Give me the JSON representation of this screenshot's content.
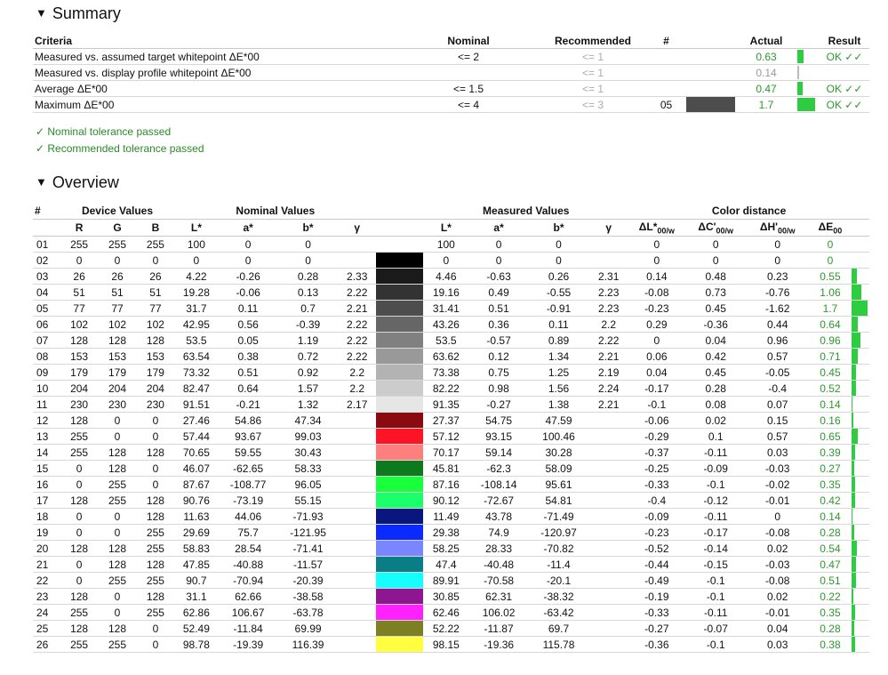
{
  "summary": {
    "title": "Summary",
    "headers": {
      "criteria": "Criteria",
      "nominal": "Nominal",
      "recommended": "Recommended",
      "num": "#",
      "actual": "Actual",
      "result": "Result"
    },
    "rows": [
      {
        "criteria": "Measured vs. assumed target whitepoint ΔE*00",
        "nominal": "<= 2",
        "recommended": "<= 1",
        "num": "",
        "swatch": "",
        "actual": "0.63",
        "bar": 0.37,
        "result": "OK ✓✓"
      },
      {
        "criteria": "Measured vs. display profile whitepoint ΔE*00",
        "nominal": "",
        "recommended": "<= 1",
        "num": "",
        "swatch": "",
        "actual": "0.14",
        "bar": 0.06,
        "result": ""
      },
      {
        "criteria": "Average ΔE*00",
        "nominal": "<= 1.5",
        "recommended": "<= 1",
        "num": "",
        "swatch": "",
        "actual": "0.47",
        "bar": 0.28,
        "result": "OK ✓✓"
      },
      {
        "criteria": "Maximum ΔE*00",
        "nominal": "<= 4",
        "recommended": "<= 3",
        "num": "05",
        "swatch": "#4d4d4d",
        "actual": "1.7",
        "bar": 1.0,
        "result": "OK ✓✓"
      }
    ],
    "pass_messages": [
      "✓ Nominal tolerance passed",
      "✓ Recommended tolerance passed"
    ]
  },
  "overview": {
    "title": "Overview",
    "group_headers": {
      "num": "#",
      "device": "Device Values",
      "nominal": "Nominal Values",
      "measured": "Measured Values",
      "distance": "Color distance"
    },
    "sub_headers": {
      "r": "R",
      "g": "G",
      "b": "B",
      "L": "L*",
      "a": "a*",
      "bb": "b*",
      "gamma": "γ",
      "mL": "L*",
      "ma": "a*",
      "mb": "b*",
      "mgamma": "γ",
      "dL": "ΔL*",
      "dL_sub": "00/w",
      "dC": "ΔC'",
      "dC_sub": "00/w",
      "dH": "ΔH'",
      "dH_sub": "00/w",
      "dE": "ΔE",
      "dE_sub": "00"
    },
    "rows": [
      {
        "n": "01",
        "r": "255",
        "g": "255",
        "b": "255",
        "L": "100",
        "a": "0",
        "bb": "0",
        "gam": "",
        "sw": "#ffffff",
        "mL": "100",
        "ma": "0",
        "mb": "0",
        "mgam": "",
        "dL": "0",
        "dC": "0",
        "dH": "0",
        "dE": "0",
        "bar": 0
      },
      {
        "n": "02",
        "r": "0",
        "g": "0",
        "b": "0",
        "L": "0",
        "a": "0",
        "bb": "0",
        "gam": "",
        "sw": "#000000",
        "mL": "0",
        "ma": "0",
        "mb": "0",
        "mgam": "",
        "dL": "0",
        "dC": "0",
        "dH": "0",
        "dE": "0",
        "bar": 0
      },
      {
        "n": "03",
        "r": "26",
        "g": "26",
        "b": "26",
        "L": "4.22",
        "a": "-0.26",
        "bb": "0.28",
        "gam": "2.33",
        "sw": "#1a1a1a",
        "mL": "4.46",
        "ma": "-0.63",
        "mb": "0.26",
        "mgam": "2.31",
        "dL": "0.14",
        "dC": "0.48",
        "dH": "0.23",
        "dE": "0.55",
        "bar": 0.55
      },
      {
        "n": "04",
        "r": "51",
        "g": "51",
        "b": "51",
        "L": "19.28",
        "a": "-0.06",
        "bb": "0.13",
        "gam": "2.22",
        "sw": "#333333",
        "mL": "19.16",
        "ma": "0.49",
        "mb": "-0.55",
        "mgam": "2.23",
        "dL": "-0.08",
        "dC": "0.73",
        "dH": "-0.76",
        "dE": "1.06",
        "bar": 1.06
      },
      {
        "n": "05",
        "r": "77",
        "g": "77",
        "b": "77",
        "L": "31.7",
        "a": "0.11",
        "bb": "0.7",
        "gam": "2.21",
        "sw": "#4d4d4d",
        "mL": "31.41",
        "ma": "0.51",
        "mb": "-0.91",
        "mgam": "2.23",
        "dL": "-0.23",
        "dC": "0.45",
        "dH": "-1.62",
        "dE": "1.7",
        "bar": 1.7
      },
      {
        "n": "06",
        "r": "102",
        "g": "102",
        "b": "102",
        "L": "42.95",
        "a": "0.56",
        "bb": "-0.39",
        "gam": "2.22",
        "sw": "#666666",
        "mL": "43.26",
        "ma": "0.36",
        "mb": "0.11",
        "mgam": "2.2",
        "dL": "0.29",
        "dC": "-0.36",
        "dH": "0.44",
        "dE": "0.64",
        "bar": 0.64
      },
      {
        "n": "07",
        "r": "128",
        "g": "128",
        "b": "128",
        "L": "53.5",
        "a": "0.05",
        "bb": "1.19",
        "gam": "2.22",
        "sw": "#808080",
        "mL": "53.5",
        "ma": "-0.57",
        "mb": "0.89",
        "mgam": "2.22",
        "dL": "0",
        "dC": "0.04",
        "dH": "0.96",
        "dE": "0.96",
        "bar": 0.96
      },
      {
        "n": "08",
        "r": "153",
        "g": "153",
        "b": "153",
        "L": "63.54",
        "a": "0.38",
        "bb": "0.72",
        "gam": "2.22",
        "sw": "#999999",
        "mL": "63.62",
        "ma": "0.12",
        "mb": "1.34",
        "mgam": "2.21",
        "dL": "0.06",
        "dC": "0.42",
        "dH": "0.57",
        "dE": "0.71",
        "bar": 0.71
      },
      {
        "n": "09",
        "r": "179",
        "g": "179",
        "b": "179",
        "L": "73.32",
        "a": "0.51",
        "bb": "0.92",
        "gam": "2.2",
        "sw": "#b3b3b3",
        "mL": "73.38",
        "ma": "0.75",
        "mb": "1.25",
        "mgam": "2.19",
        "dL": "0.04",
        "dC": "0.45",
        "dH": "-0.05",
        "dE": "0.45",
        "bar": 0.45
      },
      {
        "n": "10",
        "r": "204",
        "g": "204",
        "b": "204",
        "L": "82.47",
        "a": "0.64",
        "bb": "1.57",
        "gam": "2.2",
        "sw": "#cccccc",
        "mL": "82.22",
        "ma": "0.98",
        "mb": "1.56",
        "mgam": "2.24",
        "dL": "-0.17",
        "dC": "0.28",
        "dH": "-0.4",
        "dE": "0.52",
        "bar": 0.52
      },
      {
        "n": "11",
        "r": "230",
        "g": "230",
        "b": "230",
        "L": "91.51",
        "a": "-0.21",
        "bb": "1.32",
        "gam": "2.17",
        "sw": "#e6e6e6",
        "mL": "91.35",
        "ma": "-0.27",
        "mb": "1.38",
        "mgam": "2.21",
        "dL": "-0.1",
        "dC": "0.08",
        "dH": "0.07",
        "dE": "0.14",
        "bar": 0.14
      },
      {
        "n": "12",
        "r": "128",
        "g": "0",
        "b": "0",
        "L": "27.46",
        "a": "54.86",
        "bb": "47.34",
        "gam": "",
        "sw": "#8b0a10",
        "mL": "27.37",
        "ma": "54.75",
        "mb": "47.59",
        "mgam": "",
        "dL": "-0.06",
        "dC": "0.02",
        "dH": "0.15",
        "dE": "0.16",
        "bar": 0.16
      },
      {
        "n": "13",
        "r": "255",
        "g": "0",
        "b": "0",
        "L": "57.44",
        "a": "93.67",
        "bb": "99.03",
        "gam": "",
        "sw": "#ff1426",
        "mL": "57.12",
        "ma": "93.15",
        "mb": "100.46",
        "mgam": "",
        "dL": "-0.29",
        "dC": "0.1",
        "dH": "0.57",
        "dE": "0.65",
        "bar": 0.65
      },
      {
        "n": "14",
        "r": "255",
        "g": "128",
        "b": "128",
        "L": "70.65",
        "a": "59.55",
        "bb": "30.43",
        "gam": "",
        "sw": "#ff7f7f",
        "mL": "70.17",
        "ma": "59.14",
        "mb": "30.28",
        "mgam": "",
        "dL": "-0.37",
        "dC": "-0.11",
        "dH": "0.03",
        "dE": "0.39",
        "bar": 0.39
      },
      {
        "n": "15",
        "r": "0",
        "g": "128",
        "b": "0",
        "L": "46.07",
        "a": "-62.65",
        "bb": "58.33",
        "gam": "",
        "sw": "#0e7a1e",
        "mL": "45.81",
        "ma": "-62.3",
        "mb": "58.09",
        "mgam": "",
        "dL": "-0.25",
        "dC": "-0.09",
        "dH": "-0.03",
        "dE": "0.27",
        "bar": 0.27
      },
      {
        "n": "16",
        "r": "0",
        "g": "255",
        "b": "0",
        "L": "87.67",
        "a": "-108.77",
        "bb": "96.05",
        "gam": "",
        "sw": "#18ff3c",
        "mL": "87.16",
        "ma": "-108.14",
        "mb": "95.61",
        "mgam": "",
        "dL": "-0.33",
        "dC": "-0.1",
        "dH": "-0.02",
        "dE": "0.35",
        "bar": 0.35
      },
      {
        "n": "17",
        "r": "128",
        "g": "255",
        "b": "128",
        "L": "90.76",
        "a": "-73.19",
        "bb": "55.15",
        "gam": "",
        "sw": "#1aff6a",
        "mL": "90.12",
        "ma": "-72.67",
        "mb": "54.81",
        "mgam": "",
        "dL": "-0.4",
        "dC": "-0.12",
        "dH": "-0.01",
        "dE": "0.42",
        "bar": 0.42
      },
      {
        "n": "18",
        "r": "0",
        "g": "0",
        "b": "128",
        "L": "11.63",
        "a": "44.06",
        "bb": "-71.93",
        "gam": "",
        "sw": "#0a1680",
        "mL": "11.49",
        "ma": "43.78",
        "mb": "-71.49",
        "mgam": "",
        "dL": "-0.09",
        "dC": "-0.11",
        "dH": "0",
        "dE": "0.14",
        "bar": 0.14
      },
      {
        "n": "19",
        "r": "0",
        "g": "0",
        "b": "255",
        "L": "29.69",
        "a": "75.7",
        "bb": "-121.95",
        "gam": "",
        "sw": "#0a2aff",
        "mL": "29.38",
        "ma": "74.9",
        "mb": "-120.97",
        "mgam": "",
        "dL": "-0.23",
        "dC": "-0.17",
        "dH": "-0.08",
        "dE": "0.28",
        "bar": 0.28
      },
      {
        "n": "20",
        "r": "128",
        "g": "128",
        "b": "255",
        "L": "58.83",
        "a": "28.54",
        "bb": "-71.41",
        "gam": "",
        "sw": "#7a86ff",
        "mL": "58.25",
        "ma": "28.33",
        "mb": "-70.82",
        "mgam": "",
        "dL": "-0.52",
        "dC": "-0.14",
        "dH": "0.02",
        "dE": "0.54",
        "bar": 0.54
      },
      {
        "n": "21",
        "r": "0",
        "g": "128",
        "b": "128",
        "L": "47.85",
        "a": "-40.88",
        "bb": "-11.57",
        "gam": "",
        "sw": "#0a7e86",
        "mL": "47.4",
        "ma": "-40.48",
        "mb": "-11.4",
        "mgam": "",
        "dL": "-0.44",
        "dC": "-0.15",
        "dH": "-0.03",
        "dE": "0.47",
        "bar": 0.47
      },
      {
        "n": "22",
        "r": "0",
        "g": "255",
        "b": "255",
        "L": "90.7",
        "a": "-70.94",
        "bb": "-20.39",
        "gam": "",
        "sw": "#16ffff",
        "mL": "89.91",
        "ma": "-70.58",
        "mb": "-20.1",
        "mgam": "",
        "dL": "-0.49",
        "dC": "-0.1",
        "dH": "-0.08",
        "dE": "0.51",
        "bar": 0.51
      },
      {
        "n": "23",
        "r": "128",
        "g": "0",
        "b": "128",
        "L": "31.1",
        "a": "62.66",
        "bb": "-38.58",
        "gam": "",
        "sw": "#8e1690",
        "mL": "30.85",
        "ma": "62.31",
        "mb": "-38.32",
        "mgam": "",
        "dL": "-0.19",
        "dC": "-0.1",
        "dH": "0.02",
        "dE": "0.22",
        "bar": 0.22
      },
      {
        "n": "24",
        "r": "255",
        "g": "0",
        "b": "255",
        "L": "62.86",
        "a": "106.67",
        "bb": "-63.78",
        "gam": "",
        "sw": "#ff22ff",
        "mL": "62.46",
        "ma": "106.02",
        "mb": "-63.42",
        "mgam": "",
        "dL": "-0.33",
        "dC": "-0.11",
        "dH": "-0.01",
        "dE": "0.35",
        "bar": 0.35
      },
      {
        "n": "25",
        "r": "128",
        "g": "128",
        "b": "0",
        "L": "52.49",
        "a": "-11.84",
        "bb": "69.99",
        "gam": "",
        "sw": "#7c8022",
        "mL": "52.22",
        "ma": "-11.87",
        "mb": "69.7",
        "mgam": "",
        "dL": "-0.27",
        "dC": "-0.07",
        "dH": "0.04",
        "dE": "0.28",
        "bar": 0.28
      },
      {
        "n": "26",
        "r": "255",
        "g": "255",
        "b": "0",
        "L": "98.78",
        "a": "-19.39",
        "bb": "116.39",
        "gam": "",
        "sw": "#ffff40",
        "mL": "98.15",
        "ma": "-19.36",
        "mb": "115.78",
        "mgam": "",
        "dL": "-0.36",
        "dC": "-0.1",
        "dH": "0.03",
        "dE": "0.38",
        "bar": 0.38
      }
    ]
  },
  "colors": {
    "accent_green": "#2ecc40",
    "text_green": "#2a9a2a"
  }
}
